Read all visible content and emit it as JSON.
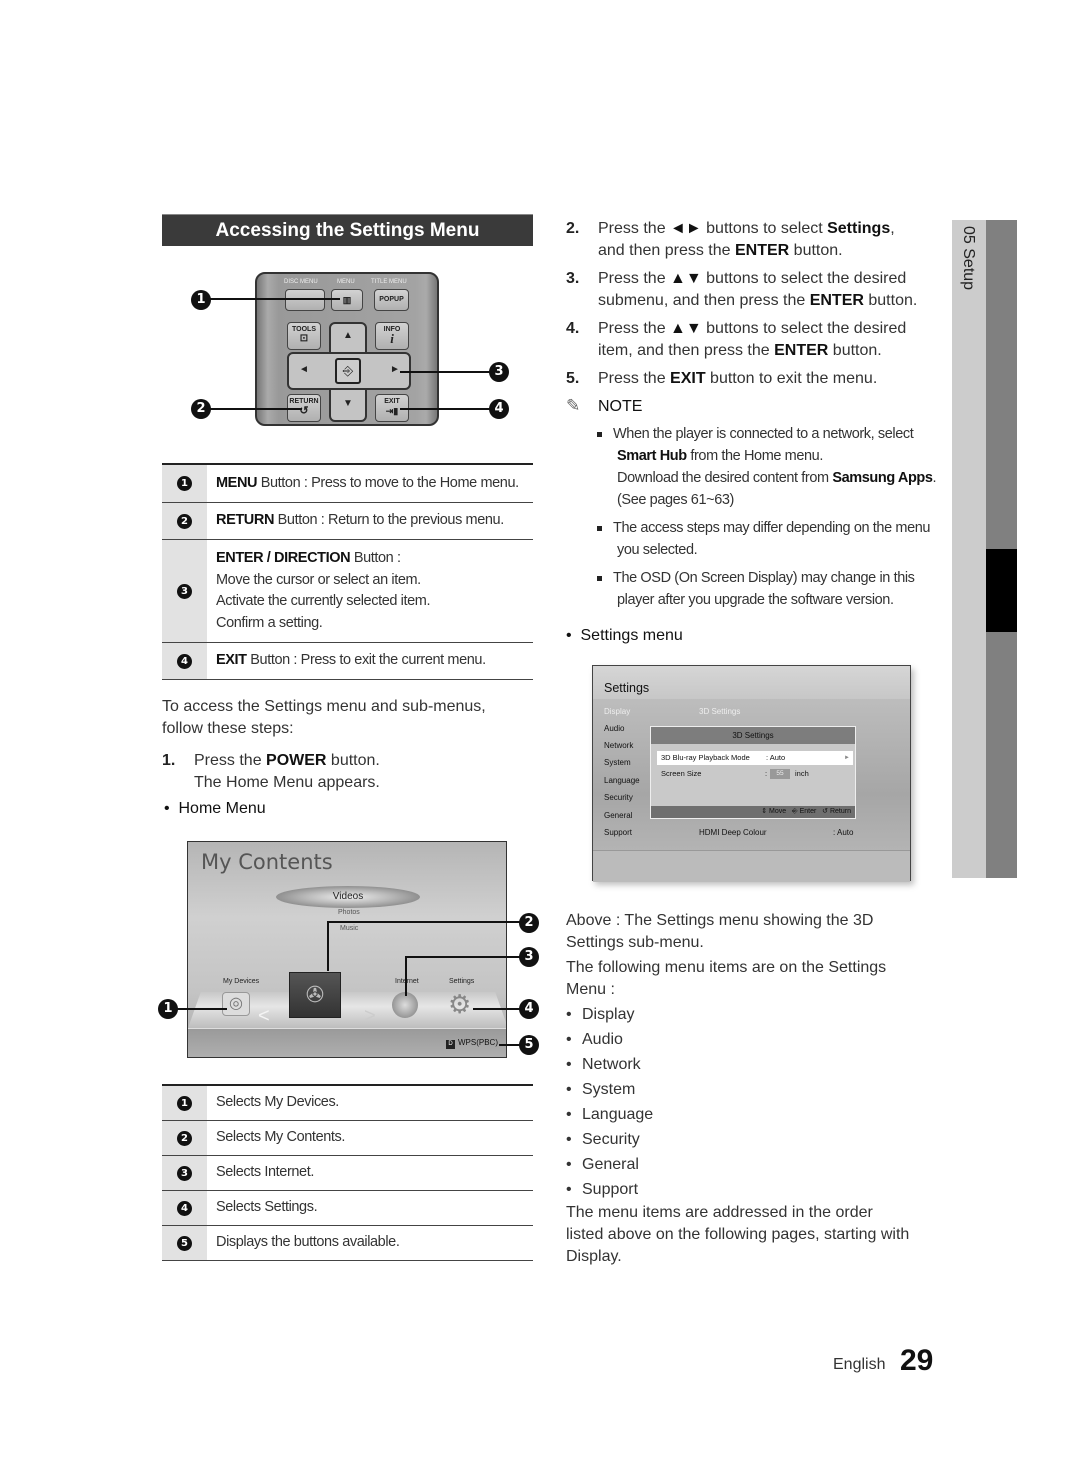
{
  "section": {
    "title": "Accessing the Settings Menu"
  },
  "remote": {
    "labels": {
      "disc_menu": "DISC MENU",
      "menu": "MENU",
      "title_menu": "TITLE MENU",
      "popup": "POPUP",
      "tools": "TOOLS",
      "info": "INFO",
      "info_glyph": "i",
      "return": "RETURN",
      "exit": "EXIT"
    },
    "icons": {
      "menu": "menu-grid-icon",
      "tools": "tools-icon",
      "enter": "enter-icon",
      "return": "return-arrow-icon",
      "exit": "exit-door-icon"
    },
    "callouts": [
      "1",
      "2",
      "3",
      "4"
    ]
  },
  "button_table": [
    {
      "num": "1",
      "bold": "MENU",
      "text": " Button : Press to move to the Home menu."
    },
    {
      "num": "2",
      "bold": "RETURN",
      "text": " Button : Return to the previous menu."
    },
    {
      "num": "3",
      "bold": "ENTER / DIRECTION",
      "text": " Button :",
      "lines": [
        "Move the cursor or select an item.",
        "Activate the currently selected item.",
        "Confirm a setting."
      ]
    },
    {
      "num": "4",
      "bold": "EXIT",
      "text": " Button : Press to exit the current menu."
    }
  ],
  "intro": {
    "text_line1": "To access the Settings menu and sub-menus,",
    "text_line2": "follow these steps:",
    "step1": {
      "num": "1.",
      "pre": "Press the ",
      "bold": "POWER",
      "post": " button.",
      "line2": "The Home Menu appears."
    },
    "bullet": "Home Menu"
  },
  "home_menu": {
    "title": "My Contents",
    "selected": "Videos",
    "sub_items": [
      "Photos",
      "Music"
    ],
    "labels": {
      "my_devices": "My Devices",
      "internet": "Internet",
      "settings": "Settings"
    },
    "wps_key": "D",
    "wps_label": "WPS(PBC)",
    "callouts": [
      "1",
      "2",
      "3",
      "4",
      "5"
    ]
  },
  "home_table": [
    {
      "num": "1",
      "text": "Selects My Devices."
    },
    {
      "num": "2",
      "text": "Selects My Contents."
    },
    {
      "num": "3",
      "text": "Selects Internet."
    },
    {
      "num": "4",
      "text": "Selects Settings."
    },
    {
      "num": "5",
      "text": "Displays the buttons available."
    }
  ],
  "steps": [
    {
      "num": "2.",
      "segments": [
        {
          "t": "Press the "
        },
        {
          "t": "◄►",
          "b": true
        },
        {
          "t": " buttons to select "
        },
        {
          "t": "Settings",
          "b": true
        },
        {
          "t": ","
        }
      ],
      "line2": [
        {
          "t": "and then press the "
        },
        {
          "t": "ENTER",
          "b": true
        },
        {
          "t": " button."
        }
      ]
    },
    {
      "num": "3.",
      "segments": [
        {
          "t": "Press the "
        },
        {
          "t": "▲▼",
          "b": true
        },
        {
          "t": " buttons to select the desired"
        }
      ],
      "line2": [
        {
          "t": "submenu, and then press the "
        },
        {
          "t": "ENTER",
          "b": true
        },
        {
          "t": " button."
        }
      ]
    },
    {
      "num": "4.",
      "segments": [
        {
          "t": "Press the "
        },
        {
          "t": "▲▼",
          "b": true
        },
        {
          "t": " buttons to select the desired"
        }
      ],
      "line2": [
        {
          "t": "item, and then press the "
        },
        {
          "t": "ENTER",
          "b": true
        },
        {
          "t": " button."
        }
      ]
    },
    {
      "num": "5.",
      "segments": [
        {
          "t": "Press the "
        },
        {
          "t": "EXIT",
          "b": true
        },
        {
          "t": " button to exit the menu."
        }
      ]
    }
  ],
  "note": {
    "icon": "pencil-note-icon",
    "label": "NOTE",
    "items": [
      {
        "lines": [
          [
            {
              "t": "When the player is connected to a network, select"
            }
          ],
          [
            {
              "t": "Smart Hub",
              "b": true
            },
            {
              "t": " from the Home menu."
            }
          ],
          [
            {
              "t": "Download the desired content from "
            },
            {
              "t": "Samsung Apps",
              "b": true
            },
            {
              "t": "."
            }
          ],
          [
            {
              "t": "(See pages 61~63)"
            }
          ]
        ]
      },
      {
        "lines": [
          [
            {
              "t": "The access steps may differ depending on the menu"
            }
          ],
          [
            {
              "t": "you selected."
            }
          ]
        ]
      },
      {
        "lines": [
          [
            {
              "t": "The OSD (On Screen Display) may change in this"
            }
          ],
          [
            {
              "t": "player after you upgrade the software version."
            }
          ]
        ]
      }
    ]
  },
  "settings_bullet": "Settings menu",
  "settings_screen": {
    "title": "Settings",
    "menu": [
      "Display",
      "Audio",
      "Network",
      "System",
      "Language",
      "Security",
      "General",
      "Support"
    ],
    "active_menu": "Display",
    "header_right": "3D Settings",
    "popup": {
      "title": "3D Settings",
      "rows": [
        {
          "label": "3D Blu-ray Playback Mode",
          "value": ": Auto"
        },
        {
          "label": "Screen Size",
          "value": ":",
          "box": "55",
          "unit": "inch"
        }
      ],
      "footer": {
        "move": "Move",
        "enter": "Enter",
        "return": "Return"
      }
    },
    "bottom_row": {
      "label": "HDMI Deep Colour",
      "value": ": Auto"
    }
  },
  "caption": {
    "line1": "Above : The Settings menu showing the 3D",
    "line2": "Settings sub-menu.",
    "list_intro1": "The following menu items are on the Settings",
    "list_intro2": "Menu :",
    "items": [
      "Display",
      "Audio",
      "Network",
      "System",
      "Language",
      "Security",
      "General",
      "Support"
    ],
    "outro1": "The menu items are addressed in the order",
    "outro2": "listed above on the following pages, starting with",
    "outro3": "Display."
  },
  "side_tab": {
    "label": "05  Setup"
  },
  "footer": {
    "language": "English",
    "page": "29"
  }
}
